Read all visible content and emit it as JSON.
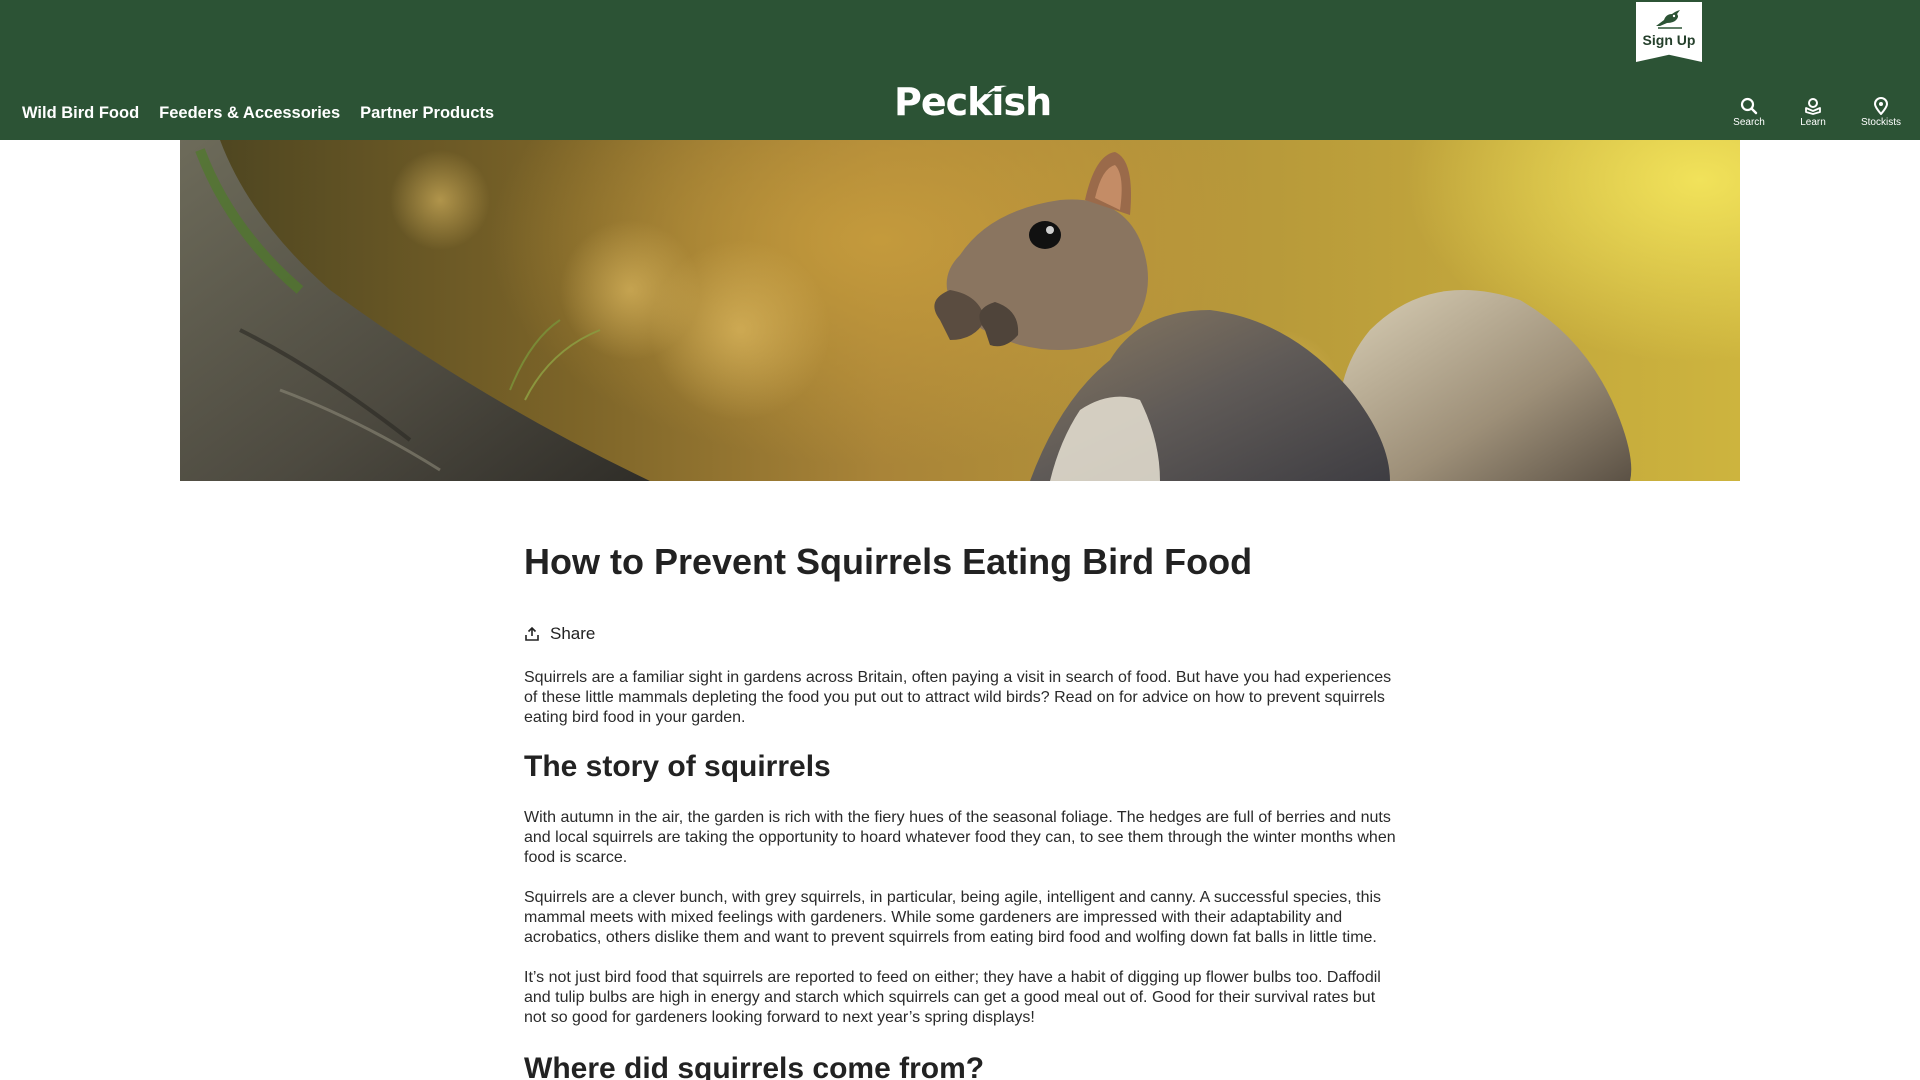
{
  "header": {
    "signup_label": "Sign Up",
    "logo_text": "Peckish",
    "nav": [
      {
        "label": "Wild Bird Food"
      },
      {
        "label": "Feeders & Accessories"
      },
      {
        "label": "Partner Products"
      }
    ],
    "tools": [
      {
        "label": "Search",
        "icon": "search-icon"
      },
      {
        "label": "Learn",
        "icon": "learn-icon"
      },
      {
        "label": "Stockists",
        "icon": "location-pin-icon"
      }
    ]
  },
  "hero": {
    "image": "squirrel-photo"
  },
  "article": {
    "title": "How to Prevent Squirrels Eating Bird Food",
    "share_label": "Share",
    "intro": "Squirrels are a familiar sight in gardens across Britain, often paying a visit in search of food. But have you had experiences of these little mammals depleting the food you put out to attract wild birds? Read on for advice on how to prevent squirrels eating bird food in your garden.",
    "section1_heading": "The story of squirrels",
    "section1_paragraphs": [
      "With autumn in the air, the garden is rich with the fiery hues of the seasonal foliage. The hedges are full of berries and nuts and local squirrels are taking the opportunity to hoard whatever food they can, to see them through the winter months when food is scarce.",
      "Squirrels are a clever bunch, with grey squirrels, in particular, being agile, intelligent and canny. A successful species, this mammal meets with mixed feelings with gardeners. While some gardeners are impressed with their adaptability and acrobatics, others dislike them and want to prevent squirrels from eating bird food and wolfing down fat balls in little time.",
      "It’s not just bird food that squirrels are reported to feed on either; they have a habit of digging up flower bulbs too. Daffodil and tulip bulbs are high in energy and starch which squirrels can get a good meal out of. Good for their survival rates but not so good for gardeners looking forward to next year’s spring displays!"
    ],
    "section2_heading": "Where did squirrels come from?"
  },
  "colors": {
    "header_bg": "#2c5335",
    "text": "#222222"
  }
}
